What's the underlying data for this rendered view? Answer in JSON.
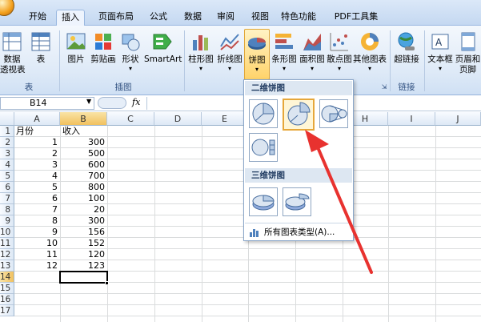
{
  "tabs": [
    "开始",
    "插入",
    "页面布局",
    "公式",
    "数据",
    "审阅",
    "视图",
    "特色功能",
    "PDF工具集"
  ],
  "active_tab": "插入",
  "ribbon": {
    "tables_buttons": [
      "数据\n透视表",
      "表"
    ],
    "tables_group": "表",
    "illustrations_buttons": [
      "图片",
      "剪贴画",
      "形状",
      "SmartArt"
    ],
    "illustrations_group": "插图",
    "charts_buttons": [
      "柱形图",
      "折线图",
      "饼图",
      "条形图",
      "面积图",
      "散点图",
      "其他图表"
    ],
    "links_buttons": [
      "超链接"
    ],
    "links_group": "链接",
    "text_buttons": [
      "文本框",
      "页眉和\n页脚"
    ]
  },
  "formula_bar": {
    "name_box": "B14",
    "fx": "fx",
    "formula": ""
  },
  "grid": {
    "columns": [
      "A",
      "B",
      "C",
      "D",
      "E",
      "F",
      "G",
      "H",
      "I",
      "J"
    ],
    "row_numbers": [
      "1",
      "2",
      "3",
      "4",
      "5",
      "6",
      "7",
      "8",
      "9",
      "10",
      "11",
      "12",
      "13",
      "14",
      "15",
      "16",
      "17"
    ],
    "header_a": "月份",
    "header_b": "收入",
    "months": [
      "1",
      "2",
      "3",
      "4",
      "5",
      "6",
      "7",
      "8",
      "9",
      "10",
      "11",
      "12"
    ],
    "incomes": [
      "300",
      "500",
      "600",
      "700",
      "800",
      "100",
      "20",
      "300",
      "156",
      "152",
      "120",
      "123"
    ],
    "selected_cell": "B14"
  },
  "popup": {
    "section_2d": "二维饼图",
    "section_3d": "三维饼图",
    "all_charts": "所有图表类型(A)..."
  },
  "colors": {
    "accent_pie": "#4472c4",
    "highlight": "#e6a73a",
    "arrow": "#e8322f"
  }
}
